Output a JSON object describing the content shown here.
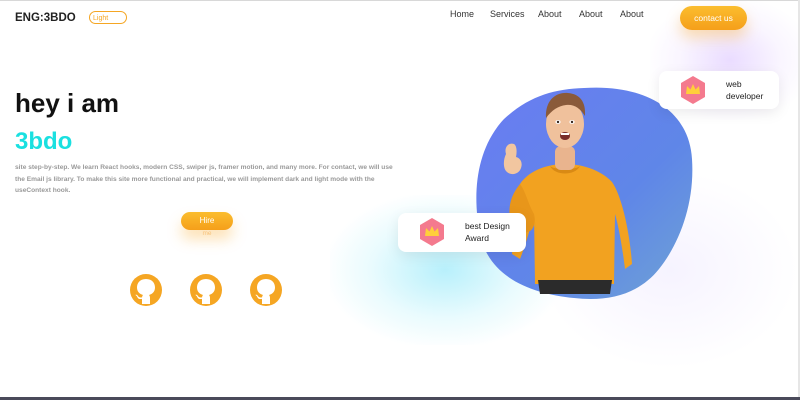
{
  "header": {
    "brand": "ENG:3BDO",
    "theme_toggle_label": "Light",
    "nav": [
      "Home",
      "Services",
      "About",
      "About",
      "About"
    ],
    "contact_button": "contact us"
  },
  "hero": {
    "greeting": "hey i am",
    "name": "3bdo",
    "description": "site step-by-step. We learn React hooks, modern CSS, swiper js, framer motion, and many more. For contact, we will use the Email js library. To make this site more functional and practical, we will implement dark and light mode with the useContext hook.",
    "hire_button": "Hire",
    "hire_button_sub": "me"
  },
  "social": [
    {
      "icon": "github-icon"
    },
    {
      "icon": "github-icon"
    },
    {
      "icon": "github-icon"
    }
  ],
  "cards": {
    "web_developer": {
      "line1": "web",
      "line2": "developer",
      "icon": "crown-icon"
    },
    "award": {
      "line1": "best Design",
      "line2": "Award",
      "icon": "crown-icon"
    }
  },
  "colors": {
    "accent_orange": "#f5a623",
    "accent_cyan": "#1ae0e0",
    "blob_blue": "#5b7ef0",
    "sweater": "#f2a220"
  }
}
